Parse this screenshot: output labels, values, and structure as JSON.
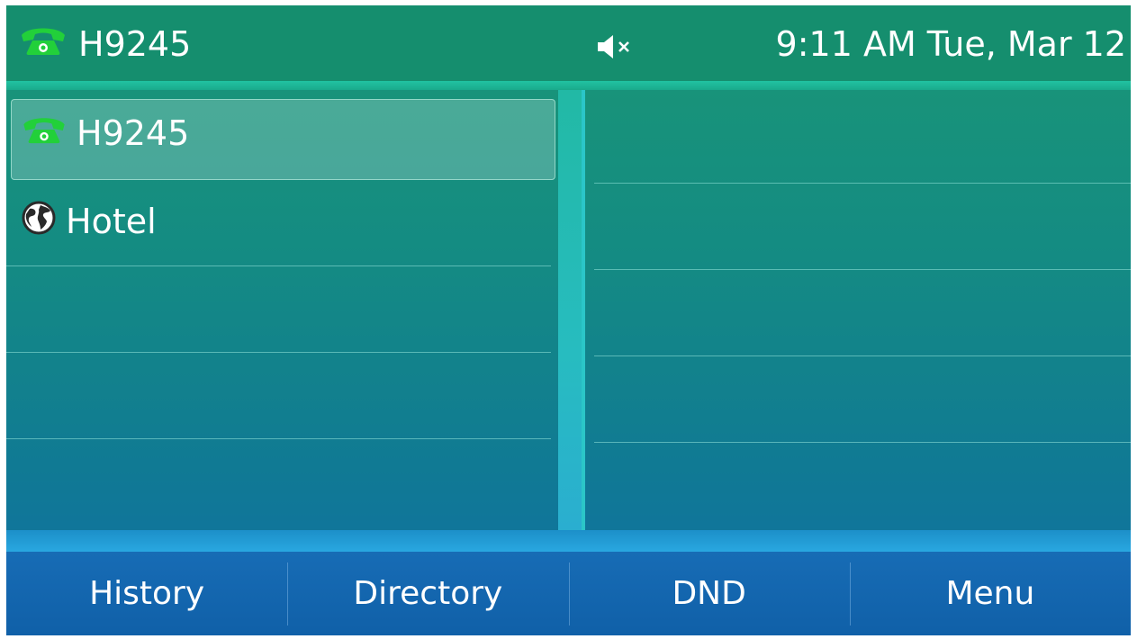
{
  "header": {
    "account_label": "H9245",
    "datetime": "9:11 AM Tue, Mar 12",
    "account_icon": "green-phone-handset",
    "status_icon": "speaker-muted"
  },
  "line_keys": [
    {
      "label": "H9245",
      "icon": "green-phone-handset",
      "selected": true
    },
    {
      "label": "Hotel",
      "icon": "globe"
    },
    {
      "label": ""
    },
    {
      "label": ""
    },
    {
      "label": ""
    }
  ],
  "softkeys": [
    {
      "label": "History"
    },
    {
      "label": "Directory"
    },
    {
      "label": "DND"
    },
    {
      "label": "Menu"
    }
  ],
  "colors": {
    "header": "#158e6e",
    "softkey_bar": "#176cb5",
    "phone_icon": "#22d03a",
    "text": "#ffffff"
  }
}
